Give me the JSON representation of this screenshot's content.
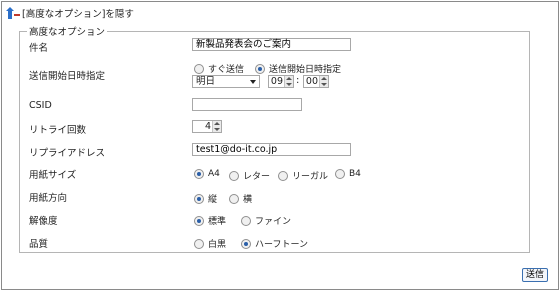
{
  "header": {
    "toggle_label": "[高度なオプション]を隠す"
  },
  "options": {
    "legend": "高度なオプション",
    "subject": {
      "label": "件名",
      "value": "新製品発表会のご案内"
    },
    "send_start": {
      "label": "送信開始日時指定",
      "radio_immediate": "すぐ送信",
      "radio_scheduled": "送信開始日時指定",
      "selected": "scheduled",
      "day": "明日",
      "hour": "09",
      "minute": "00",
      "colon": ":"
    },
    "csid": {
      "label": "CSID",
      "value": ""
    },
    "retry": {
      "label": "リトライ回数",
      "value": "4"
    },
    "reply_address": {
      "label": "リプライアドレス",
      "value": "test1@do-it.co.jp"
    },
    "paper_size": {
      "label": "用紙サイズ",
      "options": [
        "A4",
        "レター",
        "リーガル",
        "B4"
      ],
      "selected": "A4"
    },
    "paper_orientation": {
      "label": "用紙方向",
      "options": [
        "縦",
        "横"
      ],
      "selected": "縦"
    },
    "resolution": {
      "label": "解像度",
      "options": [
        "標準",
        "ファイン"
      ],
      "selected": "標準"
    },
    "quality": {
      "label": "品質",
      "options": [
        "白黒",
        "ハーフトーン"
      ],
      "selected": "ハーフトーン"
    }
  },
  "submit_label": "送信",
  "colors": {
    "arrow": "#2b6fc9",
    "minus": "#c0392b",
    "radio_dot": "#2b5fa8",
    "button_border": "#3a6fb0"
  }
}
